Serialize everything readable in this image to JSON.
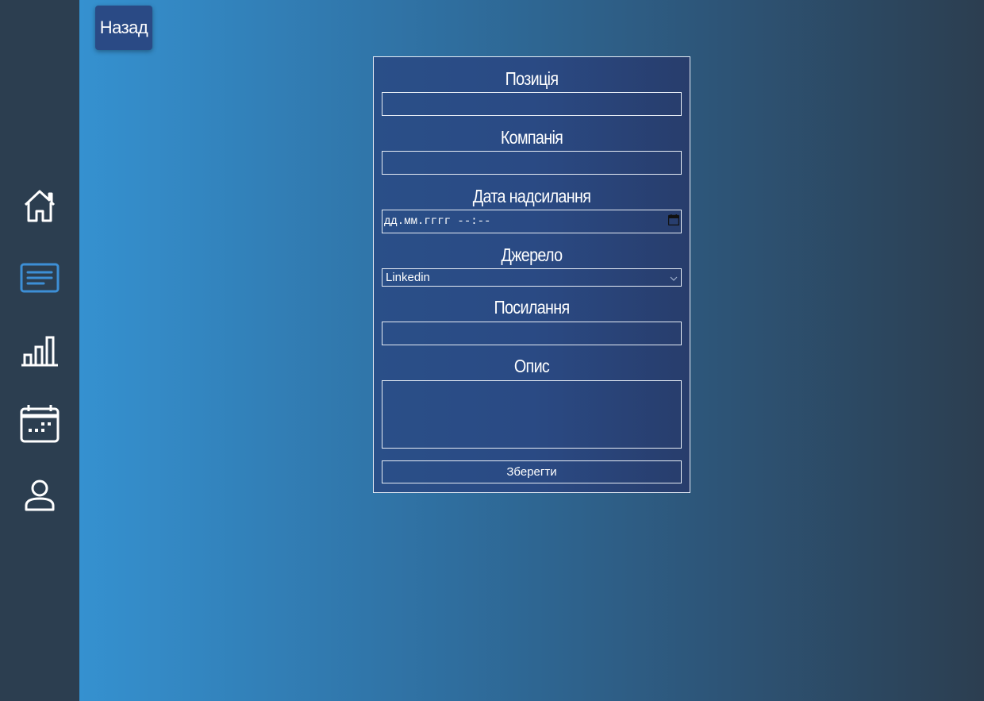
{
  "header": {
    "back_label": "Назад"
  },
  "sidebar": {
    "items": [
      {
        "name": "home",
        "icon": "home-icon",
        "active": false
      },
      {
        "name": "applications",
        "icon": "list-icon",
        "active": true
      },
      {
        "name": "stats",
        "icon": "bar-chart-icon",
        "active": false
      },
      {
        "name": "calendar",
        "icon": "calendar-icon",
        "active": false
      },
      {
        "name": "profile",
        "icon": "user-icon",
        "active": false
      }
    ],
    "active_color": "#3d8fd6",
    "icon_color": "#ffffff"
  },
  "form": {
    "position": {
      "label": "Позиція",
      "value": ""
    },
    "company": {
      "label": "Компанія",
      "value": ""
    },
    "date": {
      "label": "Дата надсилання",
      "placeholder": "дд.мм.гггг --:--"
    },
    "source": {
      "label": "Джерело",
      "selected": "Linkedin"
    },
    "link": {
      "label": "Посилання",
      "value": ""
    },
    "description": {
      "label": "Опис",
      "value": ""
    },
    "submit_label": "Зберегти"
  }
}
